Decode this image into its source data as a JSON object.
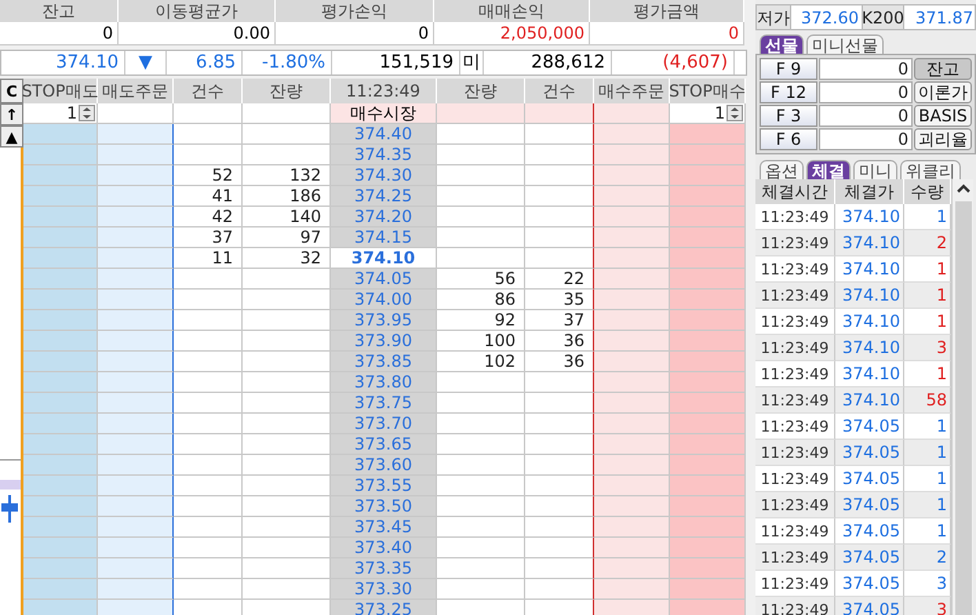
{
  "summary": {
    "columns": [
      "잔고",
      "이동평균가",
      "평가손익",
      "매매손익",
      "평가금액"
    ],
    "values": [
      {
        "text": "0",
        "color": "#000000"
      },
      {
        "text": "0.00",
        "color": "#000000"
      },
      {
        "text": "0",
        "color": "#000000"
      },
      {
        "text": "2,050,000",
        "color": "#e02020"
      },
      {
        "text": "0",
        "color": "#e02020"
      }
    ]
  },
  "quote": [
    {
      "text": "374.10",
      "color": "#1e6fe0"
    },
    {
      "text": "▼",
      "color": "#1e6fe0"
    },
    {
      "text": "6.85",
      "color": "#1e6fe0"
    },
    {
      "text": "-1.80%",
      "color": "#1e6fe0"
    },
    {
      "text": "151,519",
      "color": "#000000"
    },
    {
      "text": "미",
      "color": "#000000"
    },
    {
      "text": "288,612",
      "color": "#000000"
    },
    {
      "text": "(4,607)",
      "color": "#e02020"
    }
  ],
  "book": {
    "side_buttons": [
      "C",
      "↑",
      "▲"
    ],
    "columns": [
      "STOP매도",
      "매도주문",
      "건수",
      "잔량",
      "11:23:49",
      "잔량",
      "건수",
      "매수주문",
      "STOP매수"
    ],
    "market_row": {
      "stop_sell": "1",
      "label": "매수시장",
      "stop_buy": "1"
    },
    "rows": [
      {
        "price": "374.40",
        "sell_count": "",
        "sell_qty": "",
        "buy_qty": "",
        "buy_count": "",
        "current": false
      },
      {
        "price": "374.35",
        "sell_count": "",
        "sell_qty": "",
        "buy_qty": "",
        "buy_count": "",
        "current": false
      },
      {
        "price": "374.30",
        "sell_count": "52",
        "sell_qty": "132",
        "buy_qty": "",
        "buy_count": "",
        "current": false
      },
      {
        "price": "374.25",
        "sell_count": "41",
        "sell_qty": "186",
        "buy_qty": "",
        "buy_count": "",
        "current": false
      },
      {
        "price": "374.20",
        "sell_count": "42",
        "sell_qty": "140",
        "buy_qty": "",
        "buy_count": "",
        "current": false
      },
      {
        "price": "374.15",
        "sell_count": "37",
        "sell_qty": "97",
        "buy_qty": "",
        "buy_count": "",
        "current": false
      },
      {
        "price": "374.10",
        "sell_count": "11",
        "sell_qty": "32",
        "buy_qty": "",
        "buy_count": "",
        "current": true
      },
      {
        "price": "374.05",
        "sell_count": "",
        "sell_qty": "",
        "buy_qty": "56",
        "buy_count": "22",
        "current": false
      },
      {
        "price": "374.00",
        "sell_count": "",
        "sell_qty": "",
        "buy_qty": "86",
        "buy_count": "35",
        "current": false
      },
      {
        "price": "373.95",
        "sell_count": "",
        "sell_qty": "",
        "buy_qty": "92",
        "buy_count": "37",
        "current": false
      },
      {
        "price": "373.90",
        "sell_count": "",
        "sell_qty": "",
        "buy_qty": "100",
        "buy_count": "36",
        "current": false
      },
      {
        "price": "373.85",
        "sell_count": "",
        "sell_qty": "",
        "buy_qty": "102",
        "buy_count": "36",
        "current": false
      },
      {
        "price": "373.80",
        "sell_count": "",
        "sell_qty": "",
        "buy_qty": "",
        "buy_count": "",
        "current": false
      },
      {
        "price": "373.75",
        "sell_count": "",
        "sell_qty": "",
        "buy_qty": "",
        "buy_count": "",
        "current": false
      },
      {
        "price": "373.70",
        "sell_count": "",
        "sell_qty": "",
        "buy_qty": "",
        "buy_count": "",
        "current": false
      },
      {
        "price": "373.65",
        "sell_count": "",
        "sell_qty": "",
        "buy_qty": "",
        "buy_count": "",
        "current": false
      },
      {
        "price": "373.60",
        "sell_count": "",
        "sell_qty": "",
        "buy_qty": "",
        "buy_count": "",
        "current": false
      },
      {
        "price": "373.55",
        "sell_count": "",
        "sell_qty": "",
        "buy_qty": "",
        "buy_count": "",
        "current": false
      },
      {
        "price": "373.50",
        "sell_count": "",
        "sell_qty": "",
        "buy_qty": "",
        "buy_count": "",
        "current": false
      },
      {
        "price": "373.45",
        "sell_count": "",
        "sell_qty": "",
        "buy_qty": "",
        "buy_count": "",
        "current": false
      },
      {
        "price": "373.40",
        "sell_count": "",
        "sell_qty": "",
        "buy_qty": "",
        "buy_count": "",
        "current": false
      },
      {
        "price": "373.35",
        "sell_count": "",
        "sell_qty": "",
        "buy_qty": "",
        "buy_count": "",
        "current": false
      },
      {
        "price": "373.30",
        "sell_count": "",
        "sell_qty": "",
        "buy_qty": "",
        "buy_count": "",
        "current": false
      },
      {
        "price": "373.25",
        "sell_count": "",
        "sell_qty": "",
        "buy_qty": "",
        "buy_count": "",
        "current": false
      }
    ]
  },
  "side_panel": {
    "info": [
      "저가",
      "372.60",
      "K200",
      "371.87"
    ],
    "futures_tabs": [
      {
        "label": "선물",
        "selected": true
      },
      {
        "label": "미니선물",
        "selected": false
      }
    ],
    "contracts": [
      {
        "code": "F 9",
        "value": "0",
        "action": "잔고",
        "selected": true
      },
      {
        "code": "F 12",
        "value": "0",
        "action": "이론가",
        "selected": false
      },
      {
        "code": "F 3",
        "value": "0",
        "action": "BASIS",
        "selected": false
      },
      {
        "code": "F 6",
        "value": "0",
        "action": "괴리율",
        "selected": false
      }
    ],
    "trade_tabs": [
      {
        "label": "옵션",
        "selected": false
      },
      {
        "label": "체결",
        "selected": true
      },
      {
        "label": "미니",
        "selected": false
      },
      {
        "label": "위클리",
        "selected": false
      }
    ],
    "trades": {
      "columns": [
        "체결시간",
        "체결가",
        "수량"
      ],
      "rows": [
        {
          "time": "11:23:49",
          "price": "374.10",
          "qty": "1",
          "color": "#1e6fe0"
        },
        {
          "time": "11:23:49",
          "price": "374.10",
          "qty": "2",
          "color": "#e02020"
        },
        {
          "time": "11:23:49",
          "price": "374.10",
          "qty": "1",
          "color": "#e02020"
        },
        {
          "time": "11:23:49",
          "price": "374.10",
          "qty": "1",
          "color": "#e02020"
        },
        {
          "time": "11:23:49",
          "price": "374.10",
          "qty": "1",
          "color": "#e02020"
        },
        {
          "time": "11:23:49",
          "price": "374.10",
          "qty": "3",
          "color": "#e02020"
        },
        {
          "time": "11:23:49",
          "price": "374.10",
          "qty": "1",
          "color": "#e02020"
        },
        {
          "time": "11:23:49",
          "price": "374.10",
          "qty": "58",
          "color": "#e02020"
        },
        {
          "time": "11:23:49",
          "price": "374.05",
          "qty": "1",
          "color": "#1e6fe0"
        },
        {
          "time": "11:23:49",
          "price": "374.05",
          "qty": "1",
          "color": "#1e6fe0"
        },
        {
          "time": "11:23:49",
          "price": "374.05",
          "qty": "1",
          "color": "#1e6fe0"
        },
        {
          "time": "11:23:49",
          "price": "374.05",
          "qty": "1",
          "color": "#1e6fe0"
        },
        {
          "time": "11:23:49",
          "price": "374.05",
          "qty": "1",
          "color": "#1e6fe0"
        },
        {
          "time": "11:23:49",
          "price": "374.05",
          "qty": "2",
          "color": "#1e6fe0"
        },
        {
          "time": "11:23:49",
          "price": "374.05",
          "qty": "3",
          "color": "#1e6fe0"
        },
        {
          "time": "11:23:49",
          "price": "374.05",
          "qty": "3",
          "color": "#e02020"
        }
      ]
    }
  }
}
